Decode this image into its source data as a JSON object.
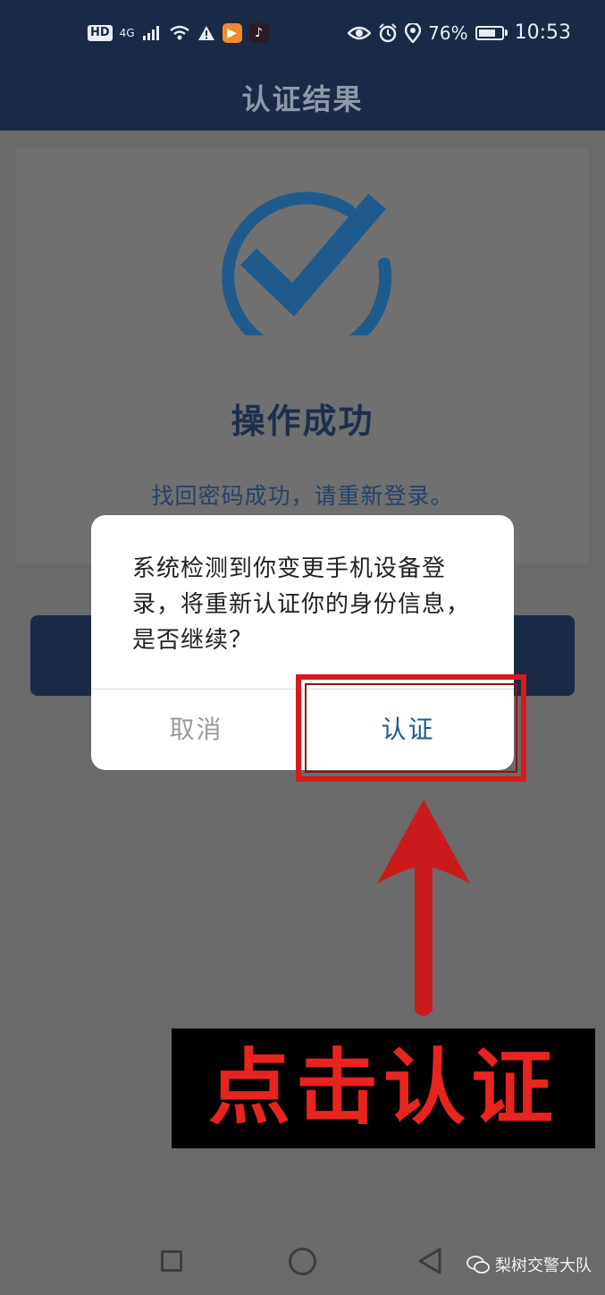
{
  "status_bar": {
    "hd": "HD",
    "network": "4G",
    "battery_percent": "76%",
    "battery_level": 0.76,
    "time": "10:53",
    "icons": [
      "signal-icon",
      "wifi-icon",
      "alert-icon",
      "video-app-icon",
      "tiktok-icon",
      "eye-icon",
      "alarm-icon",
      "location-icon",
      "battery-icon"
    ]
  },
  "header": {
    "title": "认证结果"
  },
  "result": {
    "title": "操作成功",
    "message": "找回密码成功，请重新登录。"
  },
  "dialog": {
    "message": "系统检测到你变更手机设备登录，将重新认证你的身份信息，是否继续？",
    "cancel_label": "取消",
    "confirm_label": "认证"
  },
  "annotation": {
    "text": "点击认证",
    "highlight_color": "#d41c1c"
  },
  "watermark": {
    "text": "梨树交警大队"
  },
  "colors": {
    "header_bg": "#1a2a46",
    "accent_blue": "#1e5b8c",
    "overlay_gray": "#6a6a6a"
  }
}
